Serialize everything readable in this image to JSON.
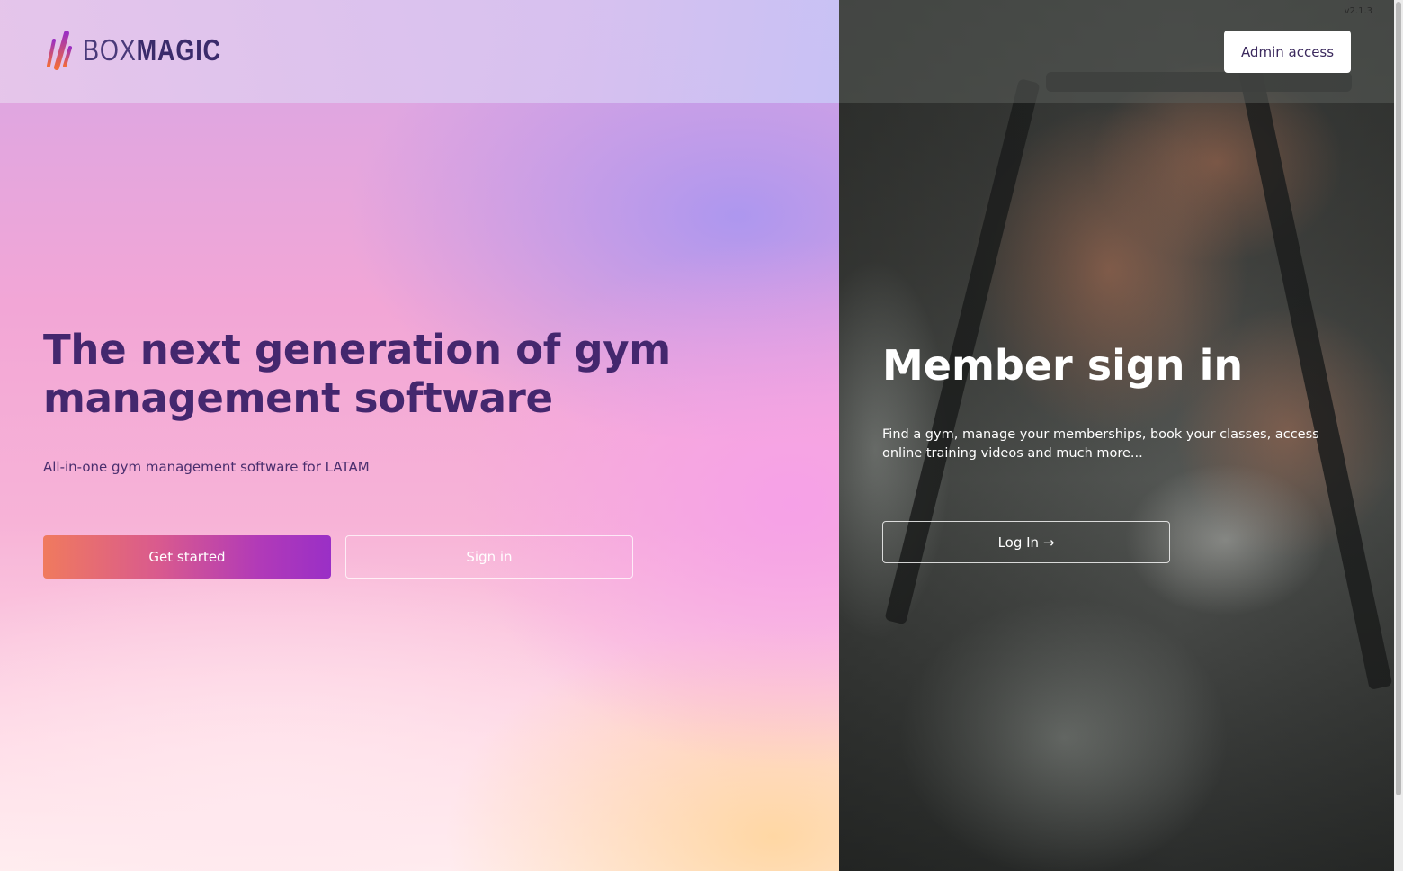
{
  "brand": {
    "name_light": "BOX",
    "name_bold": "MAGIC",
    "logo_icon": "boxmagic-logo-icon",
    "accent_colors": [
      "#f07a5e",
      "#b13ab8",
      "#44276e"
    ]
  },
  "version": "v2.1.3",
  "header": {
    "admin_label": "Admin access"
  },
  "hero": {
    "title": "The next generation of gym management software",
    "subtitle": "All-in-one gym management software for LATAM",
    "get_started_label": "Get started",
    "sign_in_label": "Sign in"
  },
  "member": {
    "title": "Member sign in",
    "description": "Find a gym, manage your memberships, book your classes, access online training videos and much more...",
    "login_label": "Log In →"
  }
}
